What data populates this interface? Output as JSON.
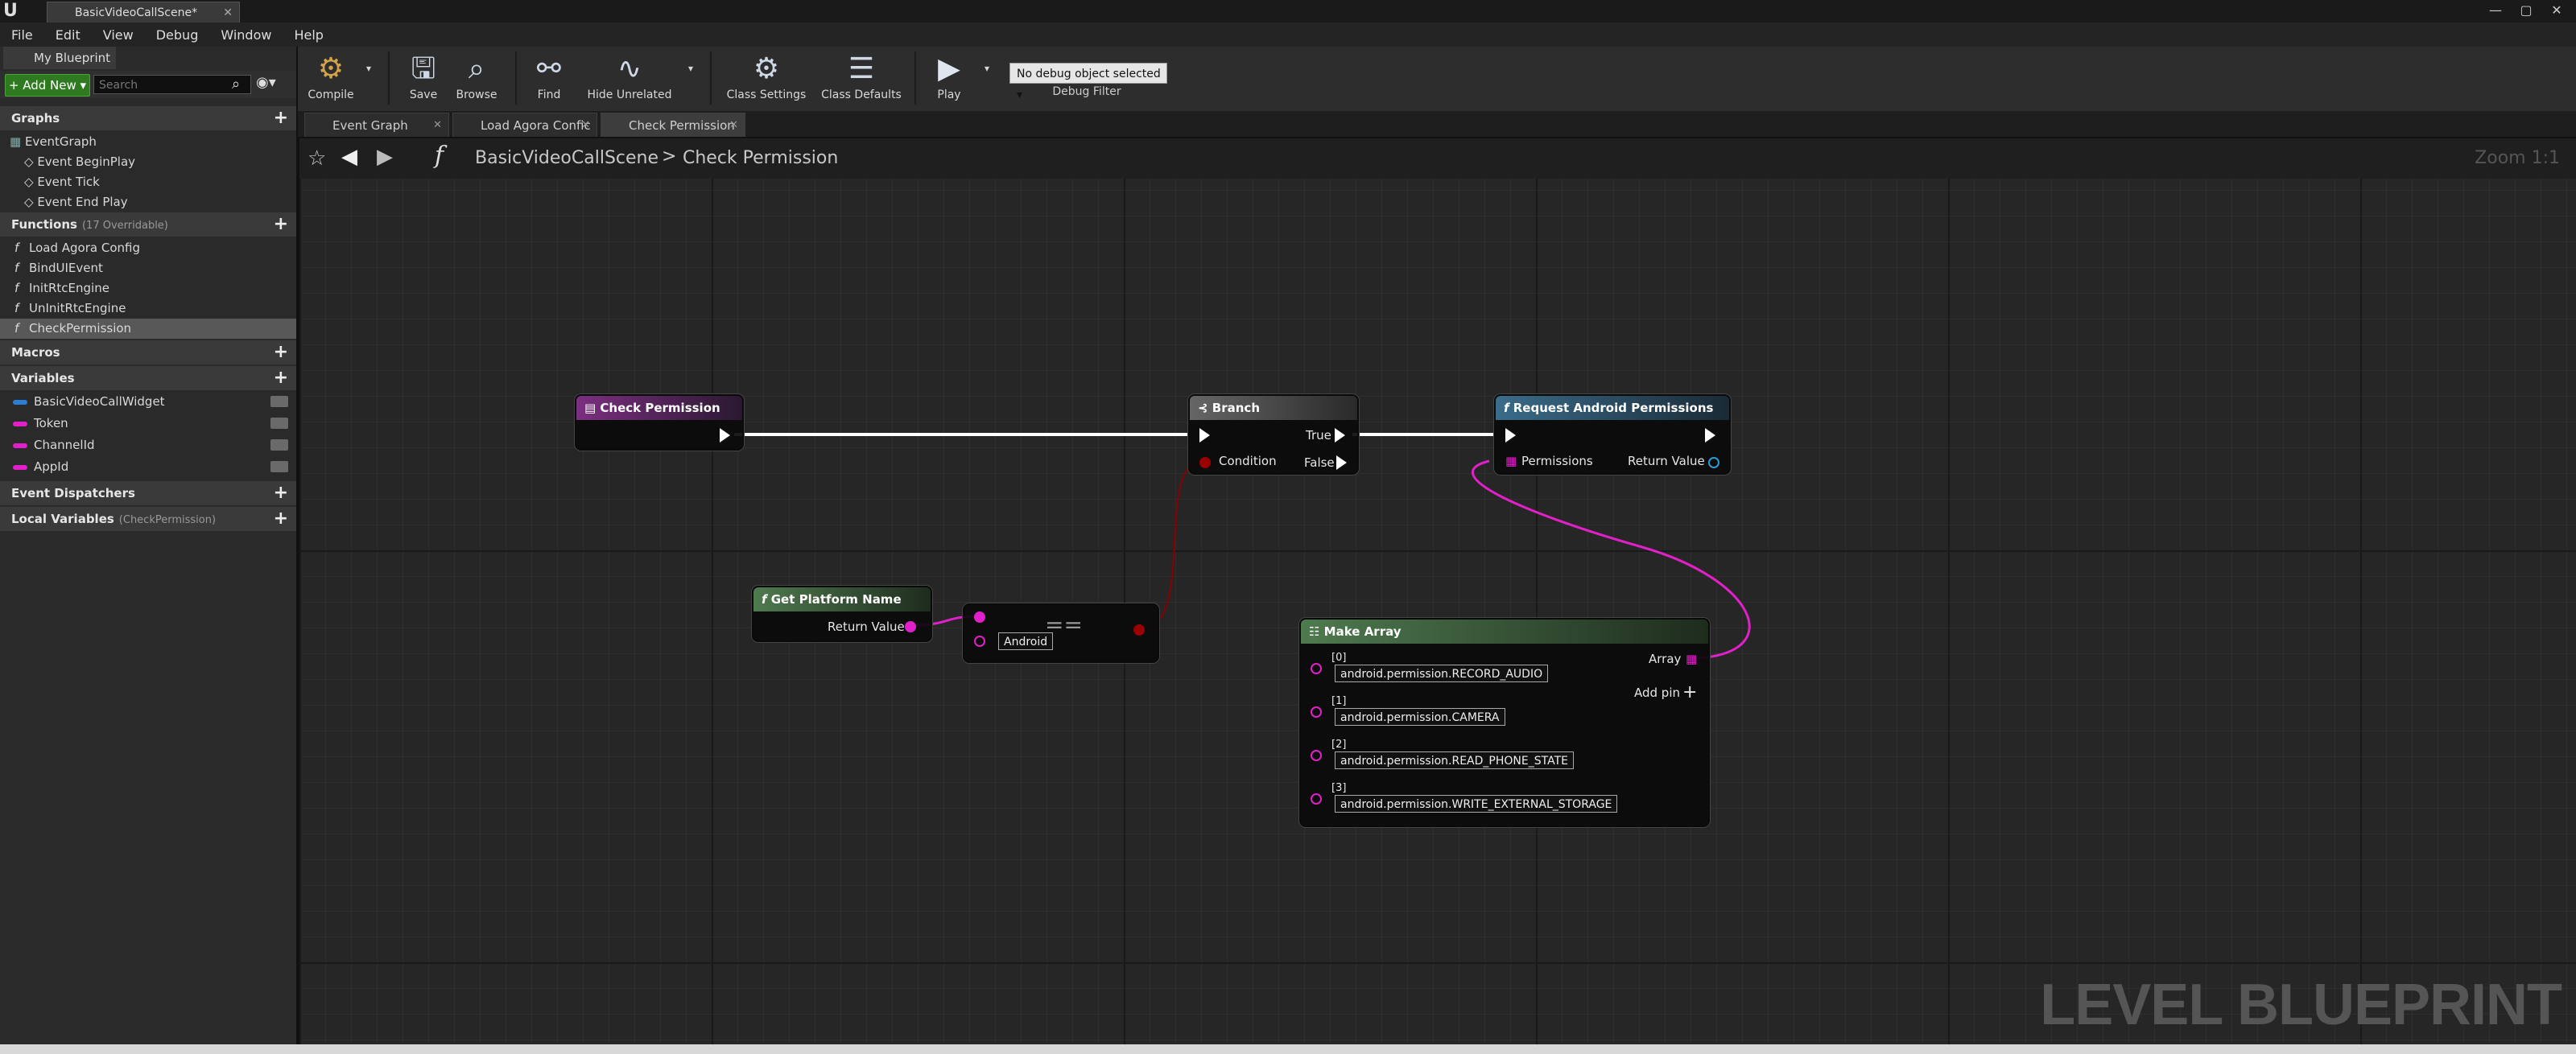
{
  "window": {
    "doc_tab": "BasicVideoCallScene*",
    "controls": [
      "—",
      "▢",
      "✕"
    ]
  },
  "menu": [
    "File",
    "Edit",
    "View",
    "Debug",
    "Window",
    "Help"
  ],
  "left_panel": {
    "tab": "My Blueprint",
    "add_new": "+ Add New ▾",
    "search_placeholder": "Search",
    "graphs_label": "Graphs",
    "graphs": [
      "EventGraph",
      "Event BeginPlay",
      "Event Tick",
      "Event End Play"
    ],
    "functions_label": "Functions",
    "functions_sub": "(17 Overridable)",
    "functions": [
      "Load Agora Config",
      "BindUIEvent",
      "InitRtcEngine",
      "UnInitRtcEngine",
      "CheckPermission"
    ],
    "macros_label": "Macros",
    "variables_label": "Variables",
    "variables": [
      {
        "name": "BasicVideoCallWidget",
        "color": "#2a7fd4"
      },
      {
        "name": "Token",
        "color": "#e020c8"
      },
      {
        "name": "ChannelId",
        "color": "#e020c8"
      },
      {
        "name": "AppId",
        "color": "#e020c8"
      }
    ],
    "dispatchers_label": "Event Dispatchers",
    "locals_label": "Local Variables",
    "locals_sub": "(CheckPermission)"
  },
  "toolbar": {
    "compile": "Compile",
    "save": "Save",
    "browse": "Browse",
    "find": "Find",
    "hide_unrelated": "Hide Unrelated",
    "class_settings": "Class Settings",
    "class_defaults": "Class Defaults",
    "play": "Play",
    "debug_select": "No debug object selected ▾",
    "debug_filter": "Debug Filter"
  },
  "graph_tabs": [
    "Event Graph",
    "Load Agora Confic",
    "Check Permission"
  ],
  "breadcrumb": {
    "scene": "BasicVideoCallScene",
    "sep": ">",
    "function": "Check Permission"
  },
  "zoom": "Zoom 1:1",
  "watermark": "LEVEL BLUEPRINT",
  "nodes": {
    "check_permission": {
      "title": "Check Permission"
    },
    "branch": {
      "title": "Branch",
      "condition": "Condition",
      "true": "True",
      "false": "False"
    },
    "request": {
      "title": "Request Android Permissions",
      "permissions": "Permissions",
      "return_value": "Return Value"
    },
    "get_platform": {
      "title": "Get Platform Name",
      "return_value": "Return Value"
    },
    "equals": {
      "op": "==",
      "literal": "Android"
    },
    "make_array": {
      "title": "Make Array",
      "array": "Array",
      "add_pin": "Add pin",
      "items": [
        {
          "index": "[0]",
          "value": "android.permission.RECORD_AUDIO"
        },
        {
          "index": "[1]",
          "value": "android.permission.CAMERA"
        },
        {
          "index": "[2]",
          "value": "android.permission.READ_PHONE_STATE"
        },
        {
          "index": "[3]",
          "value": "android.permission.WRITE_EXTERNAL_STORAGE"
        }
      ]
    }
  },
  "colors": {
    "exec": "#ffffff",
    "string": "#e020c8",
    "bool": "#9a0000",
    "function_header": "#3b6c8a",
    "pure_header": "#4f7a4f",
    "entry_header": "#6f2e74"
  }
}
